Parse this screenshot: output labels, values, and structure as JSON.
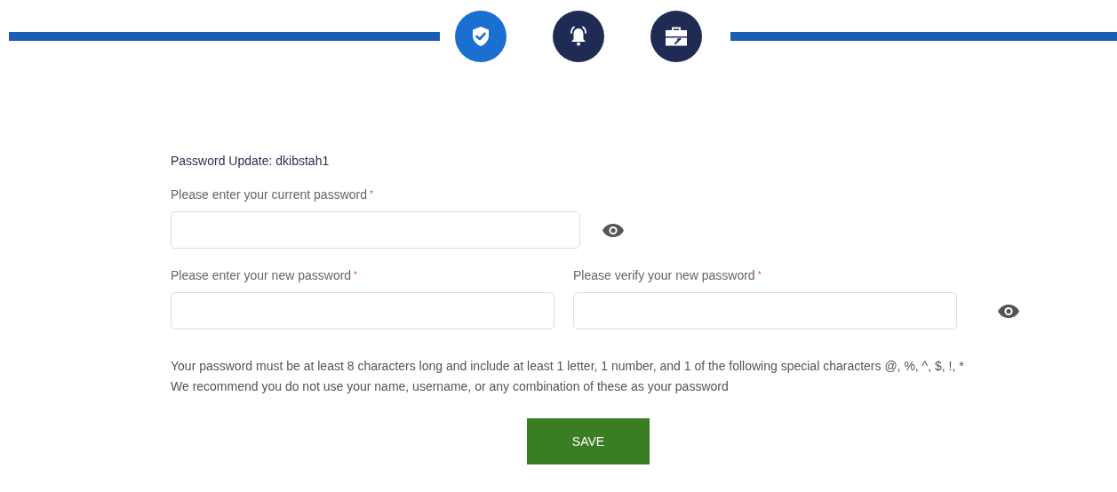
{
  "steps": [
    {
      "kind": "shield",
      "selected": true
    },
    {
      "kind": "bell",
      "selected": false
    },
    {
      "kind": "toolbox",
      "selected": false
    }
  ],
  "form": {
    "title": "Password Update: dkibstah1",
    "current": {
      "label": "Please enter your current password",
      "required_mark": "*"
    },
    "new": {
      "label": "Please enter your new password",
      "required_mark": "*"
    },
    "verify": {
      "label": "Please verify your new password",
      "required_mark": "*"
    },
    "rules": [
      "Your password must be at least 8 characters long and include at least 1 letter, 1 number, and 1 of the following special characters @, %, ^, $, !, *",
      "We recommend you do not use your name, username, or any combination of these as your password"
    ],
    "save": "SAVE"
  }
}
